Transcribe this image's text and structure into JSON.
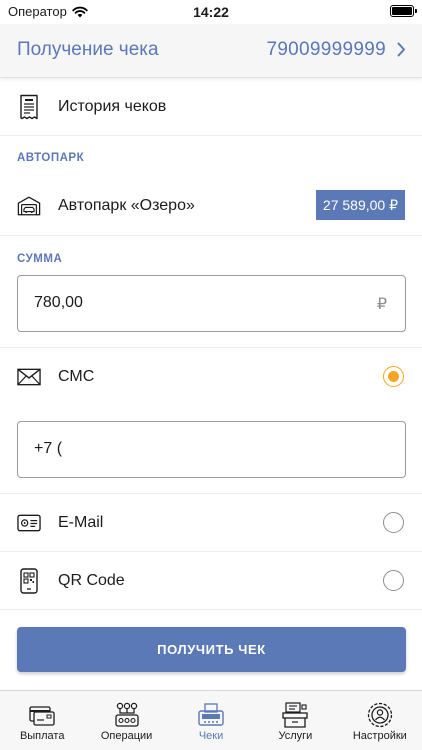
{
  "status_bar": {
    "carrier": "Оператор",
    "time": "14:22"
  },
  "header": {
    "title": "Получение чека",
    "phone": "79009999999"
  },
  "history": {
    "label": "История чеков"
  },
  "fleet": {
    "section_label": "АВТОПАРК",
    "name": "Автопарк «Озеро»",
    "balance": "27 589,00 ₽"
  },
  "amount": {
    "section_label": "СУММА",
    "value": "780,00",
    "currency": "₽"
  },
  "delivery": {
    "sms_label": "СМС",
    "sms_selected": true,
    "phone_value": "+7 (",
    "email_label": "E-Mail",
    "email_selected": false,
    "qr_label": "QR Code",
    "qr_selected": false
  },
  "submit": {
    "label": "ПОЛУЧИТЬ ЧЕК"
  },
  "tabs": [
    {
      "label": "Выплата",
      "icon": "card-payout-icon",
      "active": false
    },
    {
      "label": "Операции",
      "icon": "operations-icon",
      "active": false
    },
    {
      "label": "Чеки",
      "icon": "receipt-printer-icon",
      "active": true
    },
    {
      "label": "Услуги",
      "icon": "services-icon",
      "active": false
    },
    {
      "label": "Настройки",
      "icon": "settings-gear-icon",
      "active": false
    }
  ],
  "colors": {
    "accent": "#5a79b6",
    "radio_selected": "#f5a623"
  }
}
